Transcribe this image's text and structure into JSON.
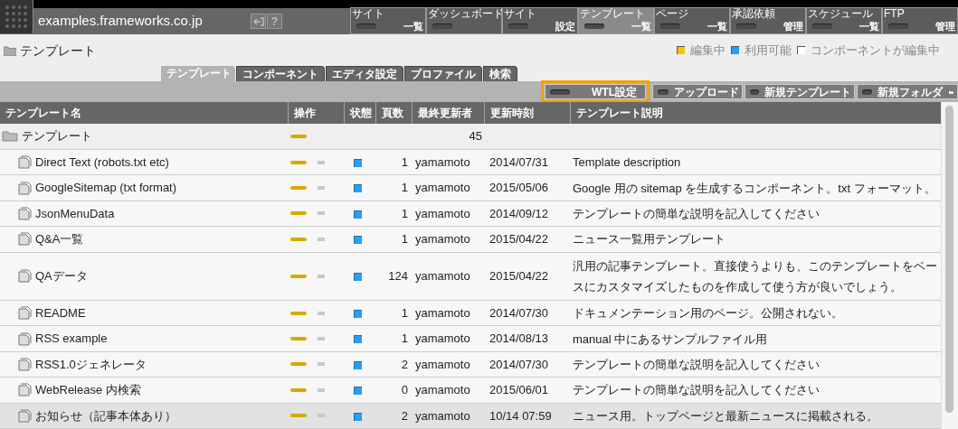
{
  "header": {
    "site": "examples.frameworks.co.jp",
    "help": "?"
  },
  "nav": [
    {
      "label": "サイト",
      "sub": "一覧",
      "selected": false
    },
    {
      "label": "ダッシュボード",
      "selected": false
    },
    {
      "label": "サイト",
      "sub": "設定",
      "selected": false
    },
    {
      "label": "テンプレート",
      "sub": "一覧",
      "selected": true
    },
    {
      "label": "ページ",
      "sub": "一覧",
      "selected": false
    },
    {
      "label": "承認依頼",
      "sub": "管理",
      "selected": false
    },
    {
      "label": "スケジュール",
      "sub": "一覧",
      "selected": false
    },
    {
      "label": "FTP",
      "sub": "管理",
      "selected": false
    }
  ],
  "page_title": "テンプレート",
  "legend": [
    {
      "label": "編集中",
      "color": "#f5c400"
    },
    {
      "label": "利用可能",
      "color": "#2a9df4"
    },
    {
      "label": "コンポーネントが編集中",
      "color": "#ffffff"
    }
  ],
  "tabs": [
    {
      "label": "テンプレート",
      "selected": true
    },
    {
      "label": "コンポーネント",
      "selected": false
    },
    {
      "label": "エディタ設定",
      "selected": false
    },
    {
      "label": "プロファイル",
      "selected": false
    },
    {
      "label": "検索",
      "selected": false
    }
  ],
  "toolbar": [
    {
      "label": "WTL設定",
      "highlighted": true
    },
    {
      "label": "アップロード",
      "highlighted": false
    },
    {
      "label": "新規テンプレート",
      "highlighted": false
    },
    {
      "label": "新規フォルダ",
      "highlighted": false,
      "folder_icon": true
    }
  ],
  "table": {
    "columns": [
      "テンプレート名",
      "操作",
      "状態",
      "頁数",
      "最終更新者",
      "更新時刻",
      "テンプレート説明"
    ],
    "rows": [
      {
        "kind": "folder",
        "name": "テンプレート",
        "count": "45",
        "selected": false
      },
      {
        "kind": "file",
        "name": "Direct Text (robots.txt etc)",
        "available": true,
        "pages": "1",
        "user": "yamamoto",
        "updated": "2014/07/31",
        "description": "Template description",
        "selected": false
      },
      {
        "kind": "file",
        "name": "GoogleSitemap (txt format)",
        "available": true,
        "pages": "1",
        "user": "yamamoto",
        "updated": "2015/05/06",
        "description": "Google 用の sitemap を生成するコンポーネント。txt フォーマット。",
        "selected": false
      },
      {
        "kind": "file",
        "name": "JsonMenuData",
        "available": true,
        "pages": "1",
        "user": "yamamoto",
        "updated": "2014/09/12",
        "description": "テンプレートの簡単な説明を記入してください",
        "selected": false
      },
      {
        "kind": "file",
        "name": "Q&A一覧",
        "available": true,
        "pages": "1",
        "user": "yamamoto",
        "updated": "2015/04/22",
        "description": "ニュース一覧用テンプレート",
        "selected": false
      },
      {
        "kind": "file",
        "name": "QAデータ",
        "available": true,
        "pages": "124",
        "user": "yamamoto",
        "updated": "2015/04/22",
        "description": "汎用の記事テンプレート。直接使うよりも、このテンプレートをベースにカスタマイズしたものを作成して使う方が良いでしょう。",
        "selected": false
      },
      {
        "kind": "file",
        "name": "README",
        "available": true,
        "pages": "1",
        "user": "yamamoto",
        "updated": "2014/07/30",
        "description": "ドキュメンテーション用のページ。公開されない。",
        "selected": false
      },
      {
        "kind": "file",
        "name": "RSS example",
        "available": true,
        "pages": "1",
        "user": "yamamoto",
        "updated": "2014/08/13",
        "description": "manual 中にあるサンプルファイル用",
        "selected": false
      },
      {
        "kind": "file",
        "name": "RSS1.0ジェネレータ",
        "available": true,
        "pages": "2",
        "user": "yamamoto",
        "updated": "2014/07/30",
        "description": "テンプレートの簡単な説明を記入してください",
        "selected": false
      },
      {
        "kind": "file",
        "name": "WebRelease 内検索",
        "available": true,
        "pages": "0",
        "user": "yamamoto",
        "updated": "2015/06/01",
        "description": "テンプレートの簡単な説明を記入してください",
        "selected": false
      },
      {
        "kind": "file",
        "name": "お知らせ（記事本体あり）",
        "available": true,
        "pages": "2",
        "user": "yamamoto",
        "updated": "10/14 07:59",
        "description": "ニュース用。トップページと最新ニュースに掲載される。",
        "selected": true
      }
    ]
  }
}
